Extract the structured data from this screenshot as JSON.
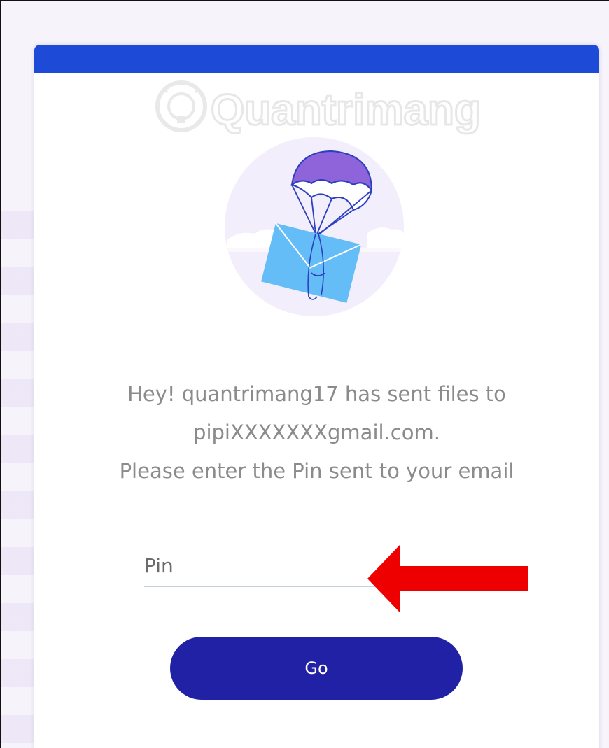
{
  "watermark": {
    "text": "Quantrimang"
  },
  "message": {
    "line1": "Hey! quantrimang17 has sent files to",
    "line2": "pipiXXXXXXXgmail.com.",
    "line3": "Please enter the Pin sent to your email"
  },
  "pin": {
    "placeholder": "Pin",
    "value": ""
  },
  "go_button": {
    "label": "Go"
  },
  "colors": {
    "top_bar": "#1e4ad8",
    "button": "#2121a5",
    "arrow": "#ee0000",
    "envelope": "#64bdf6",
    "parachute": "#8f63d9"
  },
  "icons": {
    "illustration": "parachute-envelope-icon",
    "annotation": "red-arrow-icon"
  }
}
